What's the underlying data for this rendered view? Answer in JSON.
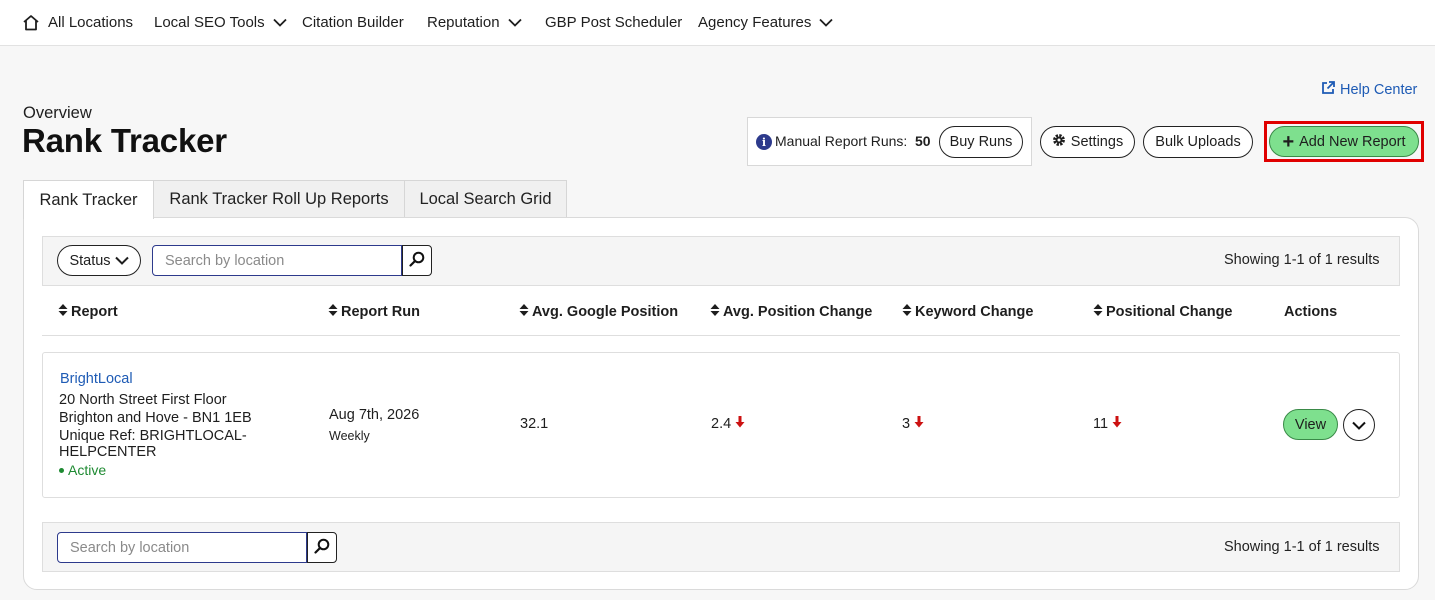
{
  "nav": {
    "items": [
      {
        "label": "All Locations",
        "icon": "home-icon"
      },
      {
        "label": "Local SEO Tools",
        "dropdown": true
      },
      {
        "label": "Citation Builder"
      },
      {
        "label": "Reputation",
        "dropdown": true
      },
      {
        "label": "GBP Post Scheduler"
      },
      {
        "label": "Agency Features",
        "dropdown": true
      }
    ]
  },
  "header": {
    "help_label": "Help Center",
    "overview_label": "Overview",
    "title": "Rank Tracker",
    "manual_runs_label": "Manual Report Runs:",
    "manual_runs_value": "50",
    "buy_runs_label": "Buy Runs",
    "settings_label": "Settings",
    "bulk_uploads_label": "Bulk Uploads",
    "add_report_label": "Add New Report"
  },
  "tabs": [
    {
      "label": "Rank Tracker",
      "active": true
    },
    {
      "label": "Rank Tracker Roll Up Reports",
      "active": false
    },
    {
      "label": "Local Search Grid",
      "active": false
    }
  ],
  "filters": {
    "status_label": "Status",
    "search_placeholder": "Search by location",
    "results_text": "Showing 1-1 of 1 results"
  },
  "table": {
    "columns": [
      "Report",
      "Report Run",
      "Avg. Google Position",
      "Avg. Position Change",
      "Keyword Change",
      "Positional Change",
      "Actions"
    ],
    "rows": [
      {
        "location_name": "BrightLocal",
        "address_line1": "20 North Street First Floor",
        "address_line2": "Brighton and Hove - BN1 1EB",
        "unique_ref_line1": "Unique Ref: BRIGHTLOCAL-",
        "unique_ref_line2": "HELPCENTER",
        "status": "Active",
        "report_run_date": "Aug 7th, 2026",
        "report_run_frequency": "Weekly",
        "avg_google_position": "32.1",
        "avg_position_change": "2.4",
        "keyword_change": "3",
        "positional_change": "11",
        "view_label": "View"
      }
    ]
  },
  "bottom": {
    "search_placeholder": "Search by location",
    "results_text": "Showing 1-1 of 1 results"
  },
  "colors": {
    "accent_green": "#7ee08e",
    "link_blue": "#1e5bb5",
    "highlight_red": "#e00000",
    "down_arrow_red": "#cc1111",
    "active_green": "#1e8a32"
  }
}
